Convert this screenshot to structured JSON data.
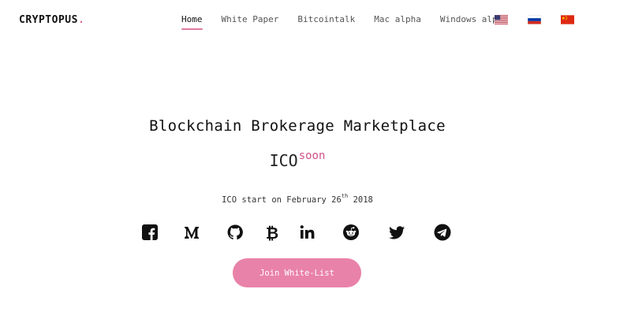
{
  "brand": {
    "name": "CRYPTOPUS",
    "dot": "."
  },
  "nav": {
    "items": [
      {
        "label": "Home",
        "active": true
      },
      {
        "label": "White Paper",
        "active": false
      },
      {
        "label": "Bitcointalk",
        "active": false
      },
      {
        "label": "Mac alpha",
        "active": false
      },
      {
        "label": "Windows alpha",
        "active": false
      }
    ]
  },
  "languages": [
    {
      "icon": "us-flag-icon"
    },
    {
      "icon": "russia-flag-icon"
    },
    {
      "icon": "china-flag-icon"
    }
  ],
  "hero": {
    "headline": "Blockchain Brokerage Marketplace",
    "ico_main": "ICO",
    "ico_sup": "soon",
    "start_prefix": "ICO start on February 26",
    "start_sup": "th",
    "start_year": " 2018"
  },
  "socials": [
    {
      "icon": "facebook-icon"
    },
    {
      "icon": "medium-icon"
    },
    {
      "icon": "github-icon"
    },
    {
      "icon": "bitcoin-icon"
    },
    {
      "icon": "linkedin-icon"
    },
    {
      "icon": "reddit-icon"
    },
    {
      "icon": "twitter-icon"
    },
    {
      "icon": "telegram-icon"
    }
  ],
  "cta": {
    "label": "Join White-List"
  },
  "colors": {
    "accent": "#e982a8",
    "accent_text": "#d0528a"
  }
}
